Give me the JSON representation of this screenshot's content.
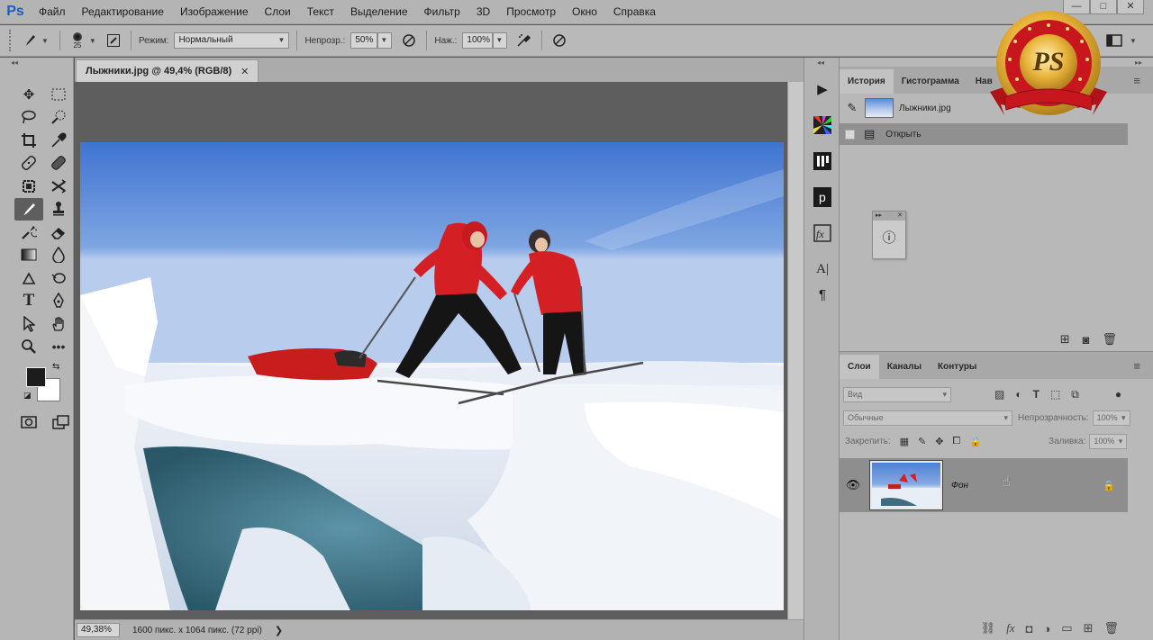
{
  "app": {
    "logo": "Ps"
  },
  "menu": [
    "Файл",
    "Редактирование",
    "Изображение",
    "Слои",
    "Текст",
    "Выделение",
    "Фильтр",
    "3D",
    "Просмотр",
    "Окно",
    "Справка"
  ],
  "window_controls": [
    "—",
    "□",
    "✕"
  ],
  "options": {
    "brush_size": "25",
    "mode_label": "Режим:",
    "mode_value": "Нормальный",
    "opacity_label": "Непрозр.:",
    "opacity_value": "50%",
    "pressure_label": "Наж.:",
    "pressure_value": "100%"
  },
  "document": {
    "tab_title": "Лыжники.jpg @ 49,4% (RGB/8)",
    "tab_close": "✕",
    "zoom": "49,38%",
    "info": "1600 пикс. x 1064 пикс. (72 ppi)",
    "status_arrow": "❯"
  },
  "history_panel": {
    "tabs": [
      "История",
      "Гистограмма",
      "Нав"
    ],
    "snapshot_name": "Лыжники.jpg",
    "steps": [
      "Открыть"
    ]
  },
  "layers_panel": {
    "tabs": [
      "Слои",
      "Каналы",
      "Контуры"
    ],
    "filter_placeholder": "Вид",
    "blend_mode": "Обычные",
    "opacity_label": "Непрозрачность:",
    "opacity_value": "100%",
    "lock_label": "Закрепить:",
    "fill_label": "Заливка:",
    "fill_value": "100%",
    "layers": [
      {
        "name": "Фон"
      }
    ]
  },
  "badge": {
    "text": "PS"
  },
  "colors": {
    "foreground": "#1c1c1c",
    "background": "#ffffff",
    "accent_red": "#c8161e",
    "gold": "#e8b33a"
  }
}
